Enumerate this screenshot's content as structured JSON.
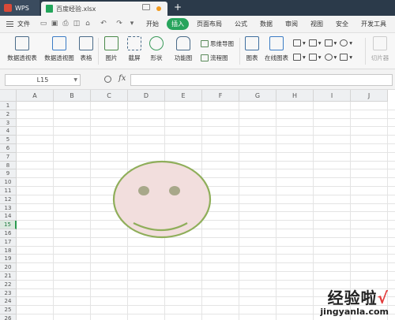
{
  "titlebar": {
    "app_tab": "WPS",
    "file_tab": "百度经验.xlsx",
    "new_tab": "+"
  },
  "menubar": {
    "file": "文件",
    "items": [
      "开始",
      "插入",
      "页面布局",
      "公式",
      "数据",
      "审阅",
      "视图",
      "安全",
      "开发工具"
    ],
    "active": "插入"
  },
  "ribbon": {
    "pivot_table": "数据透视表",
    "pivot_chart": "数据透视图",
    "table": "表格",
    "picture": "图片",
    "screenshot": "截屏",
    "shapes": "形状",
    "function_chart": "功能图",
    "mindmap": "思维导图",
    "flowchart": "流程图",
    "chart": "图表",
    "online_chart": "在线图表",
    "slicer": "切片器"
  },
  "formula": {
    "namebox": "L15",
    "fx": "fx",
    "value": ""
  },
  "sheet": {
    "columns": [
      "A",
      "B",
      "C",
      "D",
      "E",
      "F",
      "G",
      "H",
      "I",
      "J"
    ],
    "rows": [
      "1",
      "2",
      "3",
      "4",
      "5",
      "6",
      "7",
      "8",
      "9",
      "10",
      "11",
      "12",
      "13",
      "14",
      "15",
      "16",
      "17",
      "18",
      "19",
      "20",
      "21",
      "22",
      "23",
      "24",
      "25",
      "26"
    ],
    "selected_row": "15"
  },
  "drawing": {
    "shape": "smiley-face",
    "fill": "#f2dedd",
    "stroke": "#8fae5a",
    "eye_fill": "#a8a88a"
  },
  "watermark": {
    "line1": "经验啦",
    "check": "√",
    "line2": "jingyanla.com"
  }
}
